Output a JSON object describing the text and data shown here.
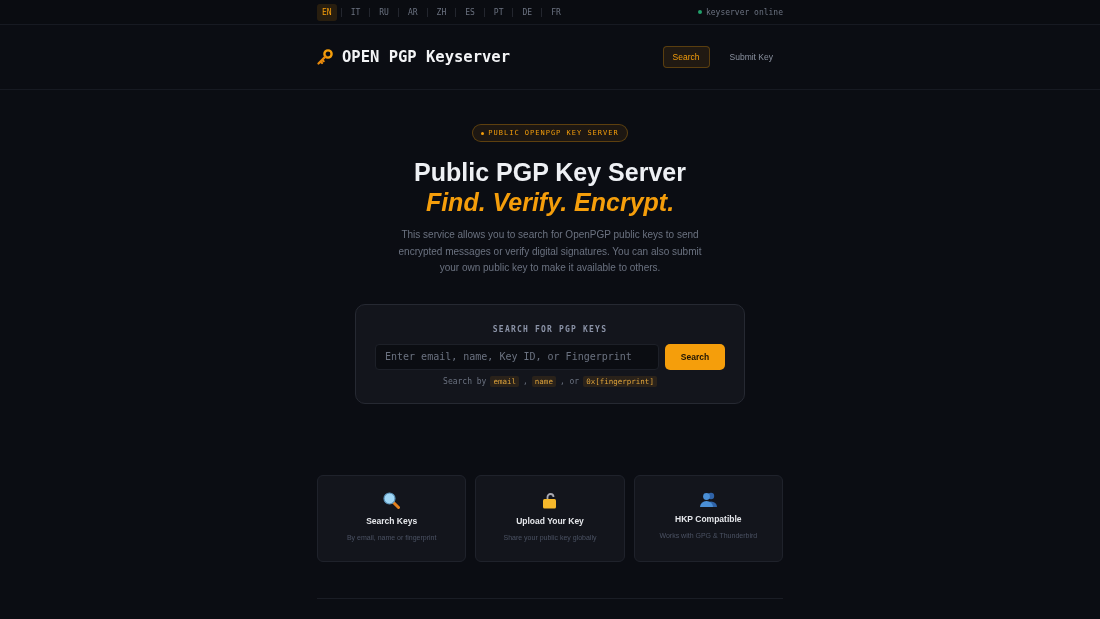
{
  "top_bar": {
    "languages": [
      {
        "code": "EN",
        "selected": true
      },
      {
        "code": "IT",
        "selected": false
      },
      {
        "code": "RU",
        "selected": false
      },
      {
        "code": "AR",
        "selected": false
      },
      {
        "code": "ZH",
        "selected": false
      },
      {
        "code": "ES",
        "selected": false
      },
      {
        "code": "PT",
        "selected": false
      },
      {
        "code": "DE",
        "selected": false
      },
      {
        "code": "FR",
        "selected": false
      }
    ],
    "status": {
      "label": "keyserver online",
      "online": true
    }
  },
  "header": {
    "logo": "OPEN PGP Keyserver",
    "nav": [
      {
        "label": "Search",
        "selected": true
      },
      {
        "label": "Submit Key",
        "selected": false
      }
    ]
  },
  "hero": {
    "badge": "PUBLIC OPENPGP KEY SERVER",
    "title": "Public PGP Key Server",
    "tagline": "Find. Verify. Encrypt.",
    "description": "This service allows you to search for OpenPGP public keys to send encrypted messages or verify digital signatures. You can also submit your own public key to make it available to others."
  },
  "search": {
    "title": "SEARCH FOR PGP KEYS",
    "placeholder": "Enter email, name, Key ID, or Fingerprint",
    "button": "Search",
    "hint": [
      {
        "kind": "text",
        "text": "Search by"
      },
      {
        "kind": "code",
        "text": "email"
      },
      {
        "kind": "text",
        "text": ","
      },
      {
        "kind": "code",
        "text": "name"
      },
      {
        "kind": "text",
        "text": ", or"
      },
      {
        "kind": "code",
        "text": "0x[fingerprint]"
      }
    ]
  },
  "features": [
    {
      "title": "Search Keys",
      "description": "By email, name or fingerprint"
    },
    {
      "title": "Upload Your Key",
      "description": "Share your public key globally"
    },
    {
      "title": "HKP Compatible",
      "description": "Works with GPG & Thunderbird"
    }
  ]
}
